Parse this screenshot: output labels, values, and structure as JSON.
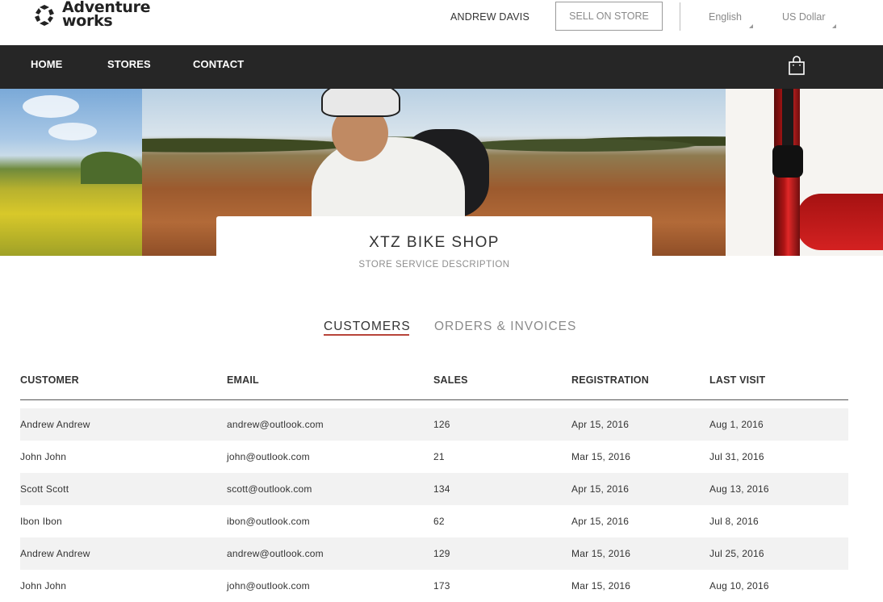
{
  "brand": {
    "line1": "Adventure",
    "line2": "works"
  },
  "header": {
    "user_name": "ANDREW DAVIS",
    "sell_button": "SELL ON STORE",
    "language": "English",
    "currency": "US Dollar"
  },
  "nav": {
    "items": [
      {
        "label": "HOME"
      },
      {
        "label": "STORES"
      },
      {
        "label": "CONTACT"
      }
    ]
  },
  "store": {
    "title": "XTZ BIKE SHOP",
    "description": "STORE SERVICE DESCRIPTION"
  },
  "tabs": [
    {
      "label": "CUSTOMERS",
      "active": true
    },
    {
      "label": "ORDERS & INVOICES",
      "active": false
    }
  ],
  "table": {
    "columns": [
      "CUSTOMER",
      "EMAIL",
      "SALES",
      "REGISTRATION",
      "LAST VISIT"
    ],
    "rows": [
      [
        "Andrew Andrew",
        "andrew@outlook.com",
        "126",
        "Apr 15, 2016",
        "Aug 1, 2016"
      ],
      [
        "John John",
        "john@outlook.com",
        "21",
        "Mar 15, 2016",
        "Jul 31, 2016"
      ],
      [
        "Scott Scott",
        "scott@outlook.com",
        "134",
        "Apr 15, 2016",
        "Aug 13, 2016"
      ],
      [
        "Ibon Ibon",
        "ibon@outlook.com",
        "62",
        "Apr 15, 2016",
        "Jul 8, 2016"
      ],
      [
        "Andrew Andrew",
        "andrew@outlook.com",
        "129",
        "Mar 15, 2016",
        "Jul 25, 2016"
      ],
      [
        "John John",
        "john@outlook.com",
        "173",
        "Mar 15, 2016",
        "Aug 10, 2016"
      ]
    ]
  },
  "colors": {
    "navbar": "#262626",
    "tab_underline": "#b8443a",
    "row_stripe": "#f2f2f2"
  },
  "icons": {
    "logo": "adventure-works-logo-icon",
    "cart": "shopping-bag-icon"
  }
}
